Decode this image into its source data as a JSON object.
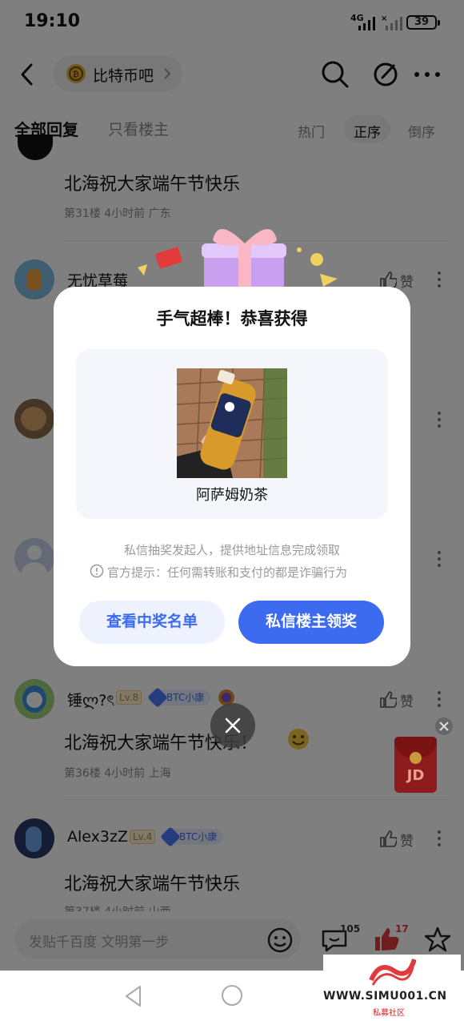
{
  "status_bar": {
    "time": "19:10",
    "network": "4G",
    "battery": "39"
  },
  "header": {
    "forum_name": "比特币吧"
  },
  "tabs": {
    "all_replies": "全部回复",
    "only_op": "只看楼主",
    "sort_hot": "热门",
    "sort_asc": "正序",
    "sort_desc": "倒序"
  },
  "posts": [
    {
      "text": "北海祝大家端午节快乐",
      "meta": "第31楼 4小时前 广东"
    },
    {
      "username": "无忧草莓",
      "like": "赞"
    },
    {
      "username": "锤ლ?ৎ",
      "level": "Lv.8",
      "badge": "BTC小康",
      "like": "赞",
      "text": "北海祝大家端午节快乐！",
      "meta": "第36楼 4小时前 上海"
    },
    {
      "username": "Alex3zZ",
      "level": "Lv.4",
      "badge": "BTC小康",
      "like": "赞",
      "text": "北海祝大家端午节快乐",
      "meta": "第37楼 4小时前 山西"
    }
  ],
  "bottom_bar": {
    "input_placeholder": "发贴千百度 文明第一步",
    "comment_count": "105",
    "like_count": "17"
  },
  "modal": {
    "title": "手气超棒！恭喜获得",
    "prize_name": "阿萨姆奶茶",
    "note": "私信抽奖发起人，提供地址信息完成领取",
    "warning": "官方提示：任何需转账和支付的都是诈骗行为",
    "btn_winners": "查看中奖名单",
    "btn_claim": "私信楼主领奖"
  },
  "floating_ad": {
    "label": "JD"
  },
  "watermark": {
    "url": "WWW.SIMU001.CN",
    "sub": "私募社区"
  },
  "colors": {
    "accent": "#3d6bf0",
    "overlay": "rgba(0,0,0,0.5)"
  }
}
